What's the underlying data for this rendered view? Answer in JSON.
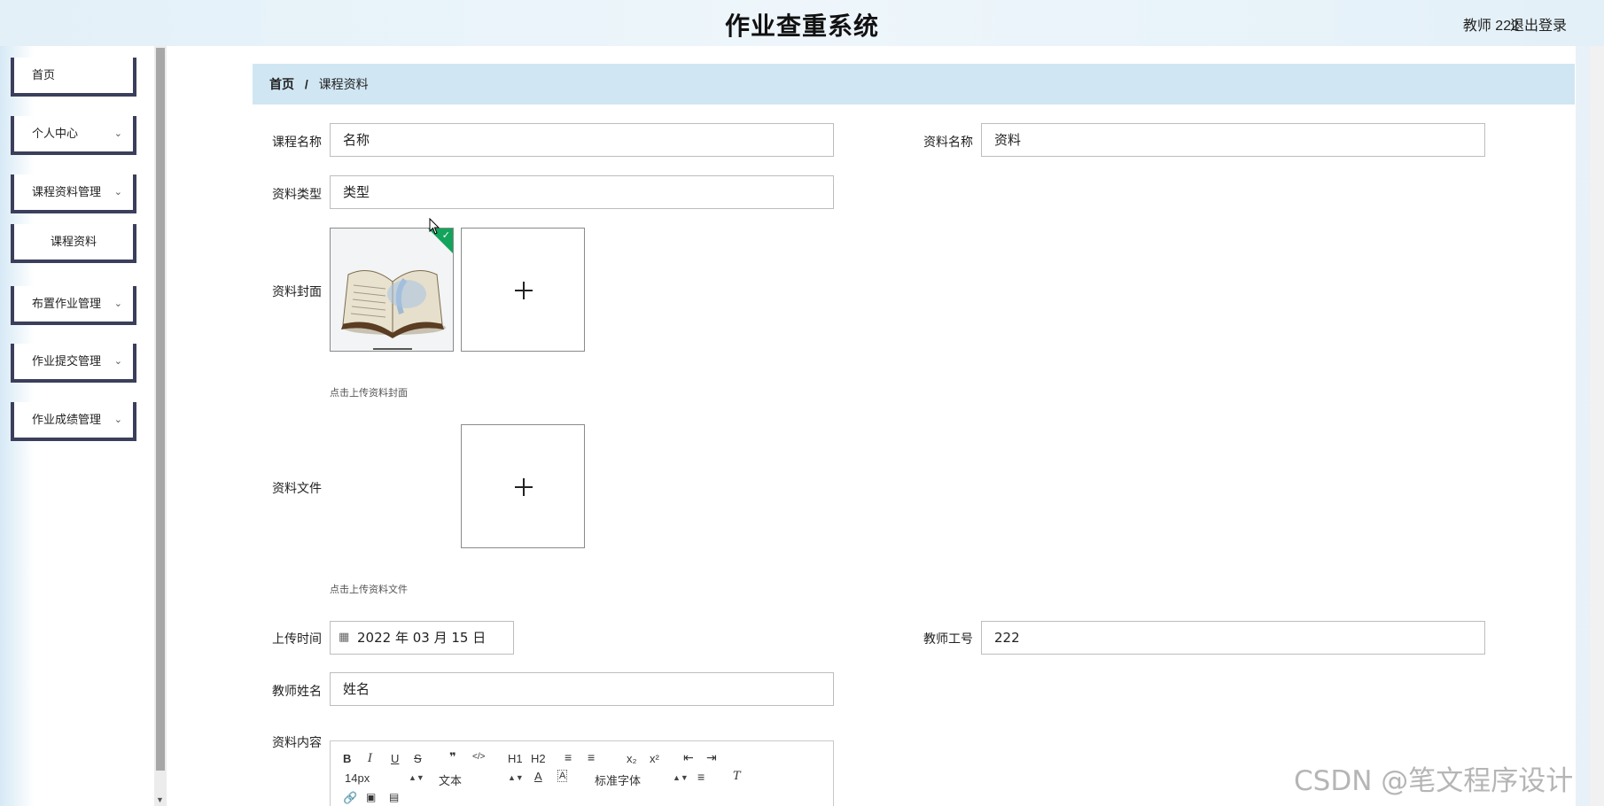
{
  "header": {
    "title": "作业查重系统",
    "user": "教师 222",
    "logout": "退出登录"
  },
  "sidebar": {
    "items": [
      {
        "label": "首页"
      },
      {
        "label": "个人中心",
        "chevron": "chevron-down-icon"
      },
      {
        "label": "课程资料管理",
        "chevron": "chevron-down-icon"
      },
      {
        "label": "课程资料"
      },
      {
        "label": "布置作业管理",
        "chevron": "chevron-down-icon"
      },
      {
        "label": "作业提交管理",
        "chevron": "chevron-down-icon"
      },
      {
        "label": "作业成绩管理",
        "chevron": "chevron-down-icon"
      }
    ]
  },
  "breadcrumb": {
    "home": "首页",
    "separator": "/",
    "current": "课程资料"
  },
  "form": {
    "course_name": {
      "label": "课程名称",
      "value": "名称"
    },
    "material_name": {
      "label": "资料名称",
      "value": "资料"
    },
    "material_type": {
      "label": "资料类型",
      "value": "类型"
    },
    "cover": {
      "label": "资料封面",
      "hint": "点击上传资料封面"
    },
    "file": {
      "label": "资料文件",
      "hint": "点击上传资料文件"
    },
    "upload_time": {
      "label": "上传时间",
      "value": "2022 年 03 月 15 日"
    },
    "teacher_id": {
      "label": "教师工号",
      "value": "222"
    },
    "teacher_name": {
      "label": "教师姓名",
      "value": "姓名"
    },
    "content": {
      "label": "资料内容"
    }
  },
  "editor": {
    "font_size": "14px",
    "paragraph": "文本",
    "font_family": "标准字体",
    "buttons": [
      "B",
      "I",
      "U",
      "S",
      "❞",
      "</>",
      "H1",
      "H2",
      "x₂",
      "x²"
    ]
  },
  "watermark": "CSDN @笔文程序设计",
  "colors": {
    "breadcrumb_bg": "#d0e6f3",
    "menu_border": "#3b3f5c",
    "upload_success": "#13a45b"
  }
}
